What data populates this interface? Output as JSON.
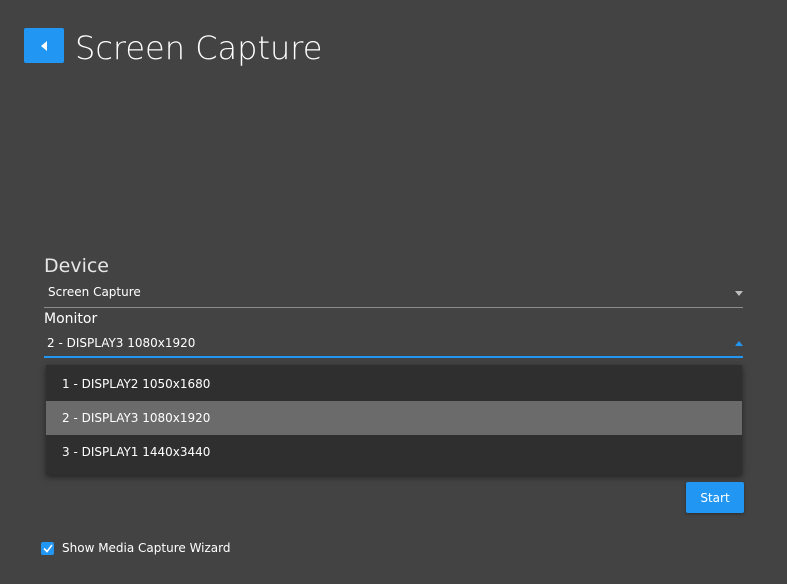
{
  "header": {
    "title": "Screen Capture",
    "back_icon": "chevron-left-icon"
  },
  "form": {
    "device": {
      "label": "Device",
      "value": "Screen Capture"
    },
    "monitor": {
      "label": "Monitor",
      "value": "2 - DISPLAY3 1080x1920",
      "options": [
        "1 - DISPLAY2 1050x1680",
        "2 - DISPLAY3 1080x1920",
        "3 - DISPLAY1 1440x3440"
      ],
      "selected_index": 1
    }
  },
  "actions": {
    "start_label": "Start"
  },
  "options": {
    "show_wizard_label": "Show Media Capture Wizard",
    "show_wizard_checked": true
  },
  "colors": {
    "background": "#434343",
    "accent": "#2196f3",
    "dropdown_bg": "#2f2f2f",
    "selected_bg": "#6b6b6b"
  }
}
